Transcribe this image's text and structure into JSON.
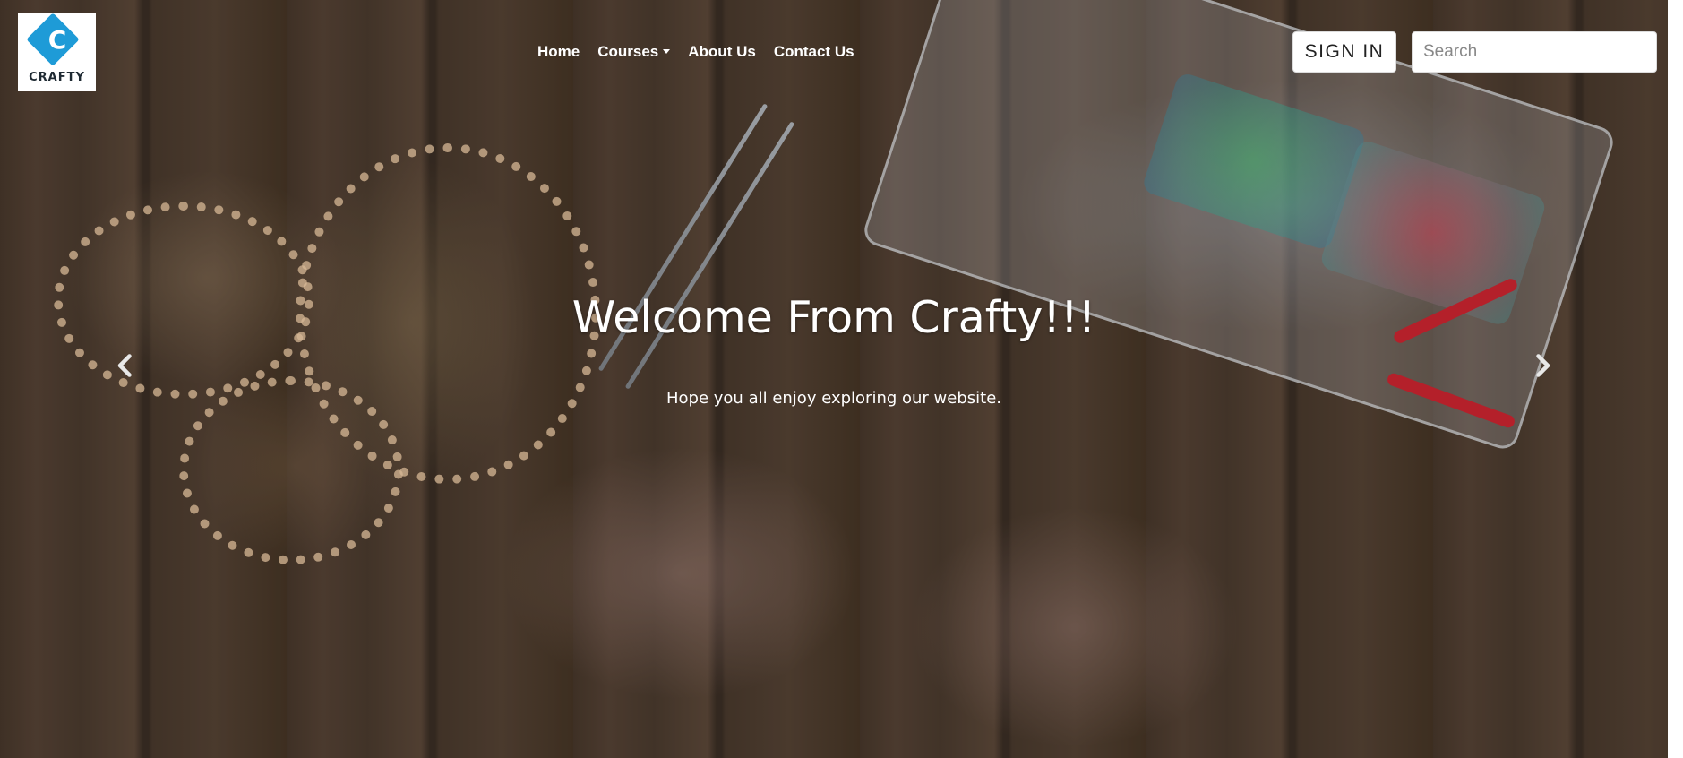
{
  "brand": {
    "logo_text": "CRAFTY",
    "logo_letter": "C",
    "accent_color": "#1e9bd7"
  },
  "nav": {
    "home": "Home",
    "courses": "Courses",
    "about": "About Us",
    "contact": "Contact Us"
  },
  "header": {
    "signin_label": "SIGN IN",
    "search_placeholder": "Search"
  },
  "hero": {
    "title": "Welcome From Crafty!!!",
    "subtitle": "Hope you all enjoy exploring our website.",
    "prev_icon": "chevron-left-icon",
    "next_icon": "chevron-right-icon"
  }
}
